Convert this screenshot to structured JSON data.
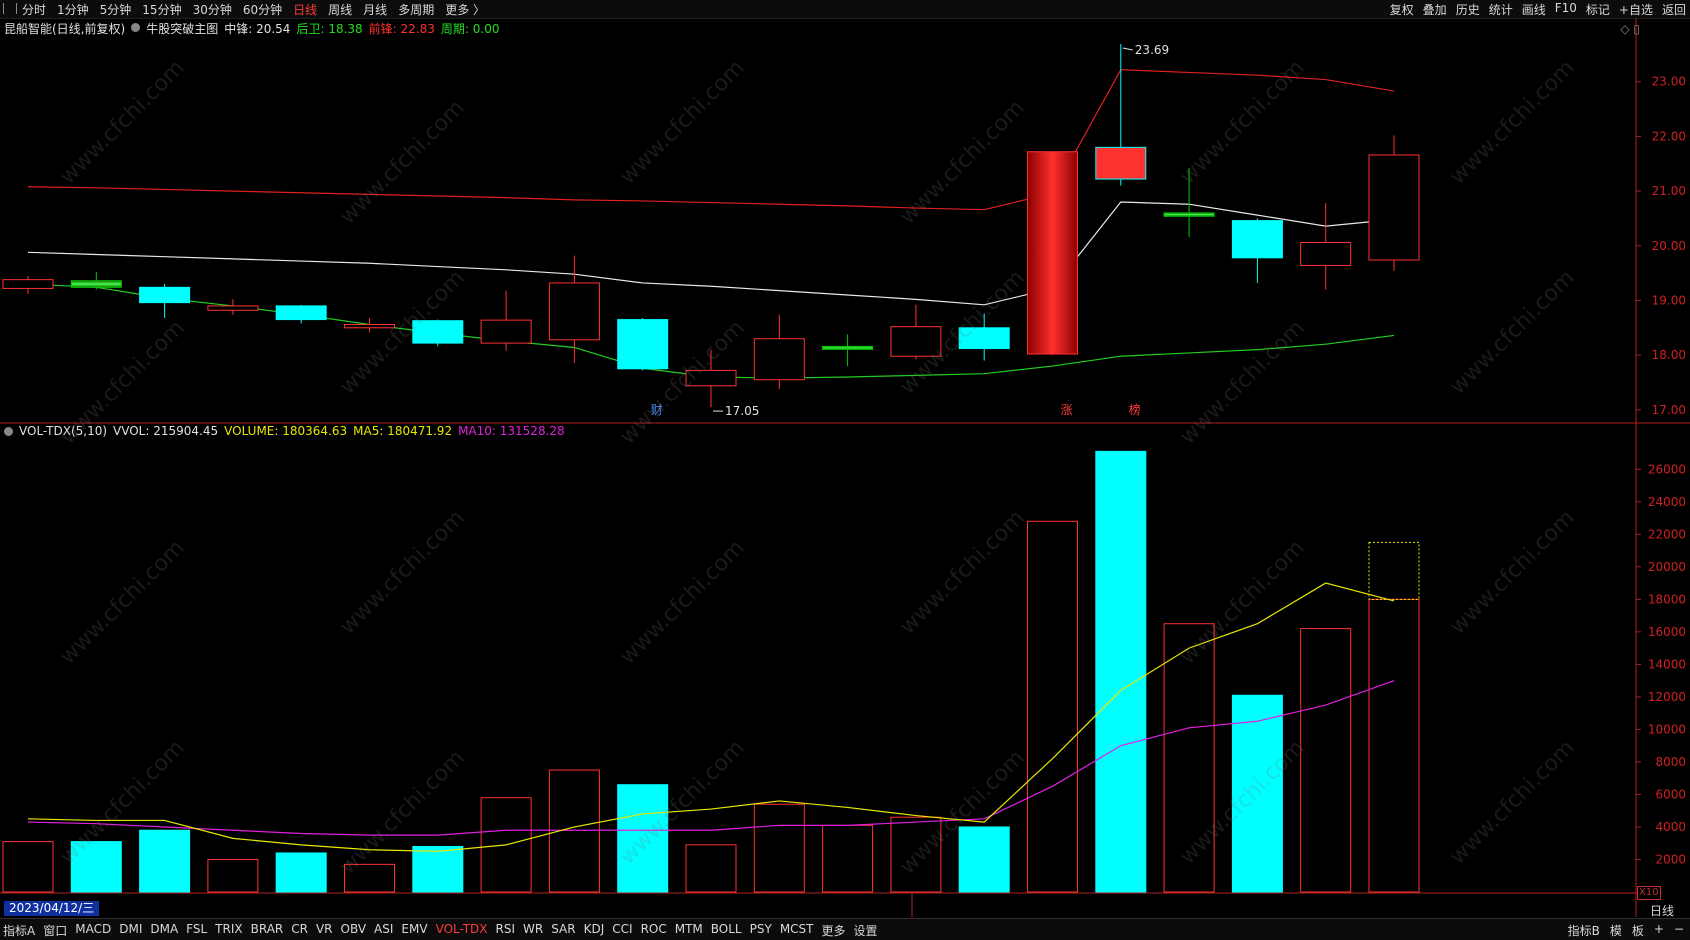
{
  "topbar": {
    "tabs": [
      "分时",
      "1分钟",
      "5分钟",
      "15分钟",
      "30分钟",
      "60分钟",
      "日线",
      "周线",
      "月线",
      "多周期",
      "更多 〉"
    ],
    "active": "日线",
    "right": [
      "复权",
      "叠加",
      "历史",
      "统计",
      "画线",
      "F10",
      "标记",
      "+自选",
      "返回"
    ]
  },
  "info": {
    "stock": "昆船智能(日线,前复权)",
    "indicator": "牛股突破主图",
    "mid_label": "中锋:",
    "mid_value": "20.54",
    "back_label": "后卫:",
    "back_value": "18.38",
    "front_label": "前锋:",
    "front_value": "22.83",
    "cycle_label": "周期:",
    "cycle_value": "0.00"
  },
  "vol_info": {
    "name": "VOL-TDX(5,10)",
    "vvol": "VVOL: 215904.45",
    "volume": "VOLUME: 180364.63",
    "ma5": "MA5: 180471.92",
    "ma10": "MA10: 131528.28"
  },
  "bottombar": {
    "items": [
      "指标A",
      "窗口",
      "MACD",
      "DMI",
      "DMA",
      "FSL",
      "TRIX",
      "BRAR",
      "CR",
      "VR",
      "OBV",
      "ASI",
      "EMV",
      "VOL-TDX",
      "RSI",
      "WR",
      "SAR",
      "KDJ",
      "CCI",
      "ROC",
      "MTM",
      "BOLL",
      "PSY",
      "MCST",
      "更多",
      "设置"
    ],
    "active": "VOL-TDX",
    "right": [
      "指标B",
      "模",
      "板",
      "+",
      "−"
    ]
  },
  "date_box": "2023/04/12/三",
  "period_label": "日线",
  "x10_label": "X10",
  "watermark": "www.cfchi.com",
  "colors": {
    "up": "#ff3232",
    "down": "#00ffff",
    "flat": "#00cc00",
    "mid_line": "#e8e8e8",
    "front_line": "#e02020",
    "back_line": "#22cc22",
    "ma5": "#e8e800",
    "ma10": "#e020e0"
  },
  "chart_data": [
    {
      "type": "candlestick",
      "y_ticks": [
        "23.00",
        "22.00",
        "21.00",
        "20.00",
        "19.00",
        "18.00",
        "17.00"
      ],
      "ylim": [
        16.85,
        23.8
      ],
      "candles": [
        {
          "o": 19.22,
          "h": 19.45,
          "l": 19.12,
          "c": 19.38,
          "kind": "up"
        },
        {
          "o": 19.36,
          "h": 19.52,
          "l": 19.2,
          "c": 19.24,
          "kind": "flat"
        },
        {
          "o": 19.24,
          "h": 19.3,
          "l": 18.68,
          "c": 18.96,
          "kind": "down"
        },
        {
          "o": 18.82,
          "h": 19.02,
          "l": 18.74,
          "c": 18.9,
          "kind": "up"
        },
        {
          "o": 18.9,
          "h": 18.92,
          "l": 18.58,
          "c": 18.65,
          "kind": "down"
        },
        {
          "o": 18.5,
          "h": 18.68,
          "l": 18.42,
          "c": 18.56,
          "kind": "up"
        },
        {
          "o": 18.63,
          "h": 18.65,
          "l": 18.16,
          "c": 18.22,
          "kind": "down"
        },
        {
          "o": 18.22,
          "h": 19.18,
          "l": 18.08,
          "c": 18.64,
          "kind": "up"
        },
        {
          "o": 18.28,
          "h": 19.82,
          "l": 17.86,
          "c": 19.32,
          "kind": "up"
        },
        {
          "o": 18.65,
          "h": 18.68,
          "l": 17.72,
          "c": 17.75,
          "kind": "down"
        },
        {
          "o": 17.44,
          "h": 18.1,
          "l": 17.05,
          "c": 17.72,
          "kind": "up"
        },
        {
          "o": 17.55,
          "h": 18.74,
          "l": 17.38,
          "c": 18.3,
          "kind": "up"
        },
        {
          "o": 18.12,
          "h": 18.38,
          "l": 17.8,
          "c": 18.16,
          "kind": "flat"
        },
        {
          "o": 17.98,
          "h": 18.92,
          "l": 17.92,
          "c": 18.52,
          "kind": "up"
        },
        {
          "o": 18.5,
          "h": 18.76,
          "l": 17.9,
          "c": 18.12,
          "kind": "down"
        },
        {
          "o": 18.02,
          "h": 21.72,
          "l": 18.0,
          "c": 21.72,
          "kind": "up"
        },
        {
          "o": 21.22,
          "h": 23.69,
          "l": 21.1,
          "c": 21.8,
          "kind": "up_alt"
        },
        {
          "o": 20.6,
          "h": 21.42,
          "l": 20.16,
          "c": 20.54,
          "kind": "flat"
        },
        {
          "o": 20.46,
          "h": 20.5,
          "l": 19.32,
          "c": 19.78,
          "kind": "down"
        },
        {
          "o": 19.64,
          "h": 20.78,
          "l": 19.2,
          "c": 20.06,
          "kind": "up"
        },
        {
          "o": 19.74,
          "h": 22.02,
          "l": 19.54,
          "c": 21.66,
          "kind": "up"
        }
      ],
      "mid_line": [
        19.88,
        19.84,
        19.8,
        19.76,
        19.72,
        19.68,
        19.62,
        19.56,
        19.48,
        19.32,
        19.26,
        19.18,
        19.1,
        19.02,
        18.92,
        19.22,
        20.8,
        20.76,
        20.56,
        20.36,
        20.48
      ],
      "front_line": [
        21.08,
        21.06,
        21.03,
        21.0,
        20.97,
        20.94,
        20.91,
        20.88,
        20.84,
        20.82,
        20.79,
        20.76,
        20.73,
        20.69,
        20.66,
        20.96,
        23.22,
        23.17,
        23.12,
        23.04,
        22.83
      ],
      "back_line": [
        19.3,
        19.24,
        19.04,
        18.9,
        18.74,
        18.56,
        18.4,
        18.26,
        18.14,
        17.76,
        17.6,
        17.58,
        17.6,
        17.63,
        17.66,
        17.8,
        17.98,
        18.04,
        18.1,
        18.2,
        18.36
      ],
      "high_label": "23.69",
      "low_label": "17.05",
      "markers": [
        {
          "i": 9,
          "text": "财",
          "color": "#3c8cff"
        },
        {
          "i": 15,
          "text": "涨",
          "color": "#ff3a3a"
        },
        {
          "i": 16,
          "text": "榜",
          "color": "#ff3a3a"
        }
      ]
    },
    {
      "type": "bar",
      "y_ticks": [
        "26000",
        "24000",
        "22000",
        "20000",
        "18000",
        "16000",
        "14000",
        "12000",
        "10000",
        "8000",
        "6000",
        "4000",
        "2000"
      ],
      "ylim": [
        0,
        27800
      ],
      "values": [
        3100,
        3100,
        3800,
        2000,
        2400,
        1700,
        2800,
        5800,
        7500,
        6600,
        2900,
        5400,
        4100,
        4600,
        4000,
        22800,
        27100,
        16500,
        12100,
        16200,
        18000
      ],
      "fill": [
        false,
        true,
        true,
        false,
        true,
        false,
        true,
        false,
        false,
        true,
        false,
        false,
        false,
        false,
        true,
        false,
        true,
        false,
        true,
        false,
        false
      ],
      "ma5": [
        4500,
        4400,
        4400,
        3300,
        2900,
        2600,
        2500,
        2900,
        4000,
        4800,
        5100,
        5600,
        5200,
        4700,
        4300,
        8200,
        12400,
        15000,
        16500,
        19000,
        17900
      ],
      "ma10": [
        4300,
        4200,
        4000,
        3800,
        3600,
        3500,
        3500,
        3800,
        3800,
        3800,
        3800,
        4100,
        4100,
        4300,
        4500,
        6500,
        9000,
        10100,
        10500,
        11500,
        13000
      ],
      "last_forecast": 21500
    }
  ]
}
